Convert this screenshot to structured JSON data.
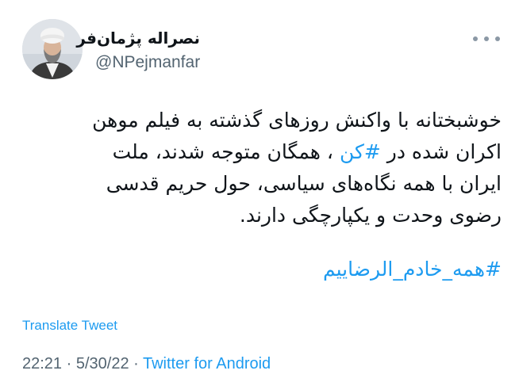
{
  "author": {
    "display_name": "نصراله پژمان‌فر",
    "handle": "@NPejmanfar"
  },
  "icons": {
    "more": "more-options-icon",
    "avatar": "profile-photo"
  },
  "tweet": {
    "line1": "خوشبختانه با واکنش روزهای گذشته به فیلم موهن",
    "line2_before": "اکران شده در ",
    "line2_link": "#کن",
    "line2_after": " ، همگان متوجه شدند، ملت",
    "line3": "ایران با همه نگاه‌های سیاسی، حول حریم قدسی",
    "line4": "رضوی وحدت و یکپارچگی دارند.",
    "hashtag": "#همه_خادم_الرضاییم"
  },
  "translate_label": "Translate Tweet",
  "meta": {
    "time": "22:21",
    "sep1": " · ",
    "date": "5/30/22",
    "sep2": " · ",
    "source": "Twitter for Android"
  },
  "colors": {
    "link": "#1d9bf0",
    "secondary_text": "#536471",
    "primary_text": "#0f1419"
  }
}
